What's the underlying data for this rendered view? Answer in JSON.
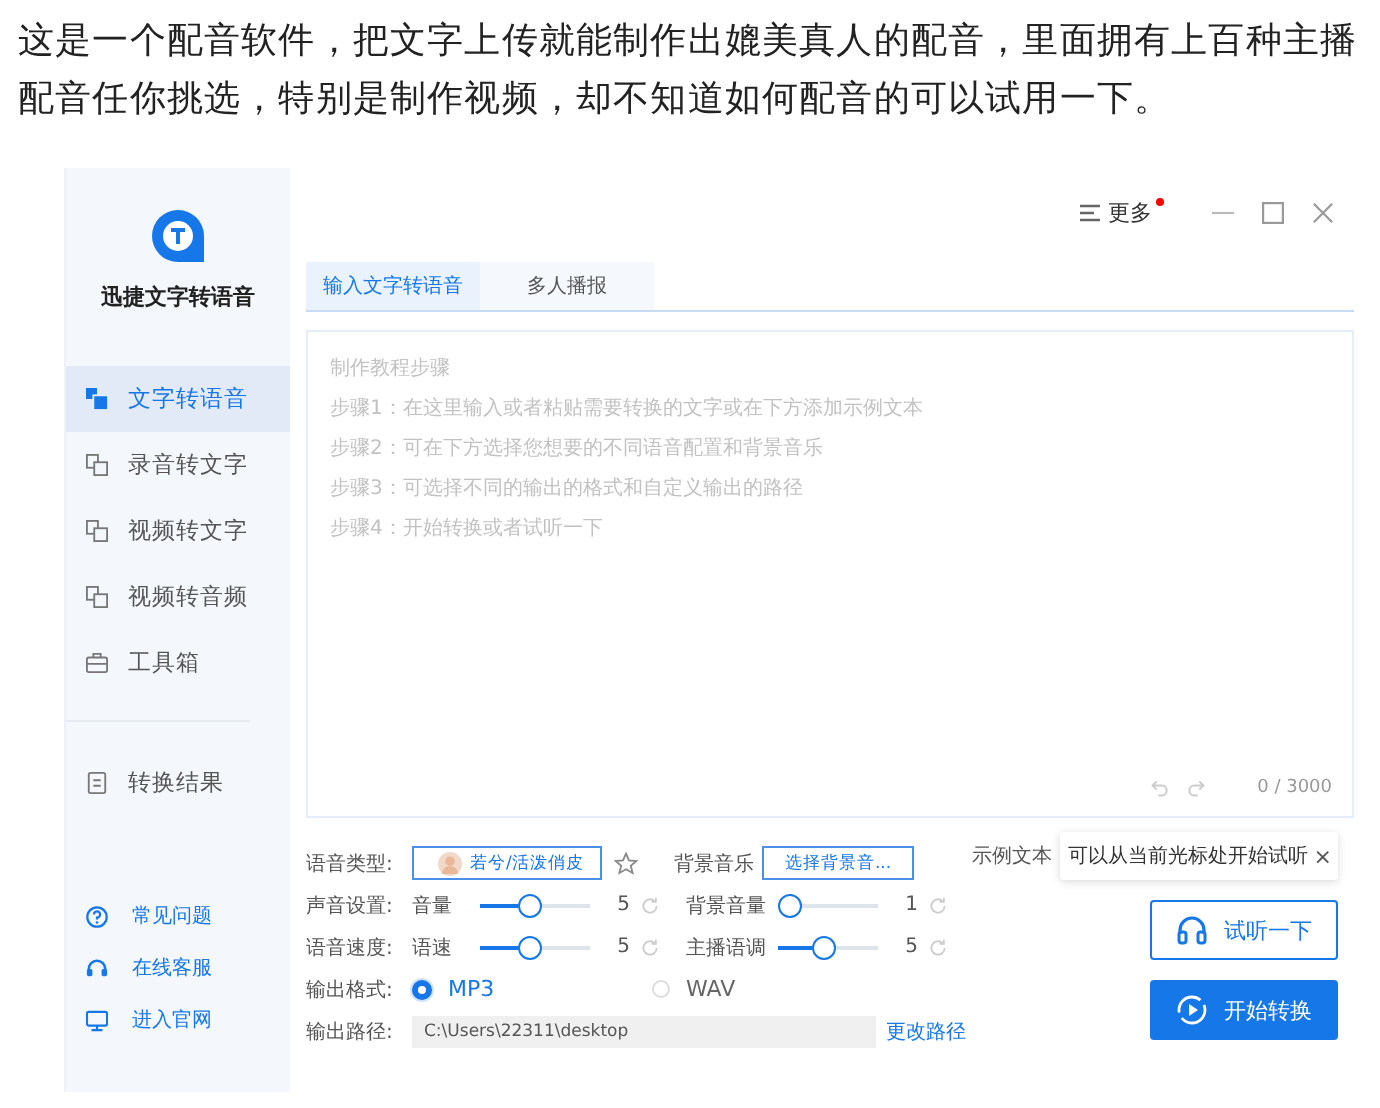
{
  "intro": "这是一个配音软件，把文字上传就能制作出媲美真人的配音，里面拥有上百种主播配音任你挑选，特别是制作视频，却不知道如何配音的可以试用一下。",
  "app": {
    "logo_title": "迅捷文字转语音",
    "nav": [
      {
        "label": "文字转语音",
        "selected": true
      },
      {
        "label": "录音转文字",
        "selected": false
      },
      {
        "label": "视频转文字",
        "selected": false
      },
      {
        "label": "视频转音频",
        "selected": false
      },
      {
        "label": "工具箱",
        "selected": false
      }
    ],
    "result_item": {
      "label": "转换结果",
      "selected": false
    },
    "links": [
      {
        "label": "常见问题"
      },
      {
        "label": "在线客服"
      },
      {
        "label": "进入官网"
      }
    ],
    "more": {
      "label": "更多",
      "notification": true
    },
    "tabs": [
      {
        "label": "输入文字转语音",
        "selected": true
      },
      {
        "label": "多人播报",
        "selected": false
      }
    ],
    "editor": {
      "placeholder_lines": [
        "制作教程步骤",
        "步骤1：在这里输入或者粘贴需要转换的文字或在下方添加示例文本",
        "步骤2：可在下方选择您想要的不同语音配置和背景音乐",
        "步骤3：可选择不同的输出的格式和自定义输出的路径",
        "步骤4：开始转换或者试听一下"
      ],
      "counter": "0 / 3000"
    },
    "voice": {
      "label": "语音类型:",
      "value": "若兮/活泼俏皮",
      "favorite": false
    },
    "music": {
      "label": "背景音乐",
      "value": "选择背景音..."
    },
    "sample": {
      "label": "示例文本",
      "tooltip": "可以从当前光标处开始试听",
      "close": "×"
    },
    "slider_rows": [
      {
        "label": "声音设置:",
        "sliders": [
          {
            "name": "音量",
            "level": 0.45,
            "reading": "5"
          },
          {
            "name": "背景音量",
            "level": 0,
            "reading": "1"
          }
        ]
      },
      {
        "label": "语音速度:",
        "sliders": [
          {
            "name": "语速",
            "level": 0.45,
            "reading": "5"
          },
          {
            "name": "主播语调",
            "level": 0.45,
            "reading": "5"
          }
        ]
      }
    ],
    "format": {
      "label": "输出格式:",
      "options": [
        {
          "label": "MP3",
          "selected": true
        },
        {
          "label": "WAV",
          "selected": false
        }
      ]
    },
    "path": {
      "label": "输出路径:",
      "value": "C:\\Users\\22311\\desktop",
      "change": "更改路径"
    },
    "listen_button": "试听一下",
    "convert_button": "开始转换"
  }
}
